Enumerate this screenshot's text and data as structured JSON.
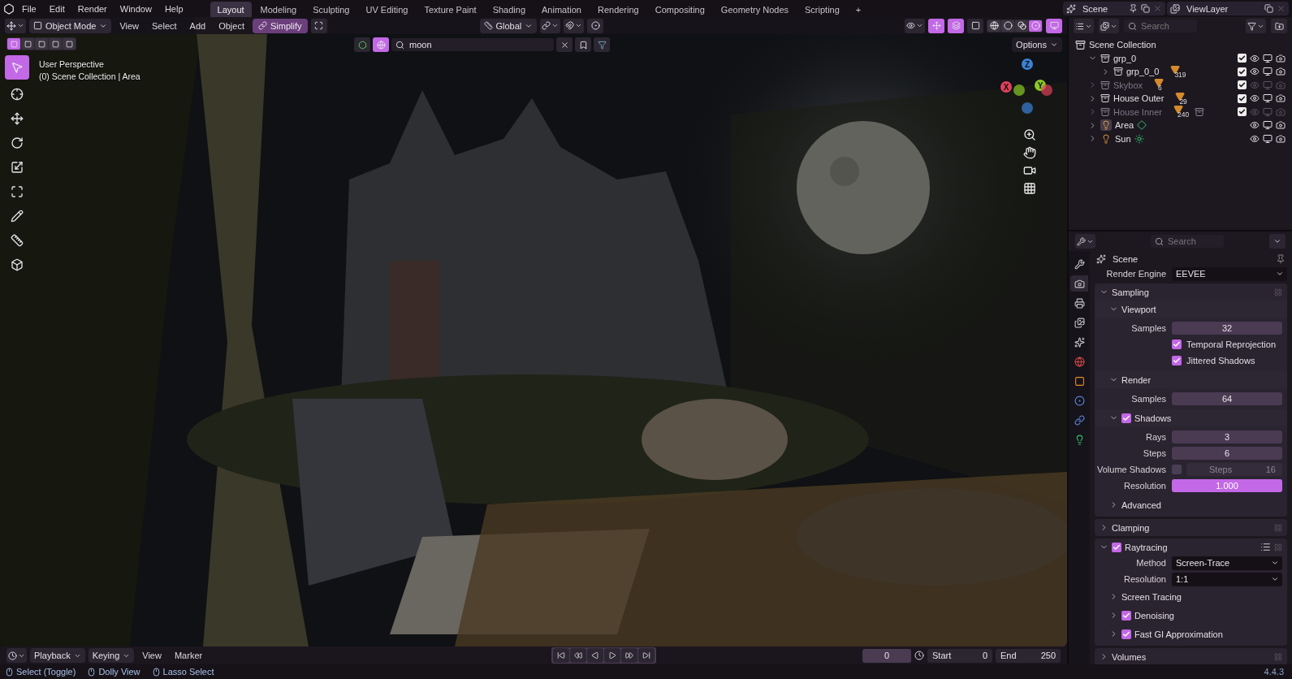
{
  "menu": [
    "File",
    "Edit",
    "Render",
    "Window",
    "Help"
  ],
  "workspaces": [
    {
      "label": "Layout",
      "selected": true
    },
    {
      "label": "Modeling",
      "selected": false
    },
    {
      "label": "Sculpting",
      "selected": false
    },
    {
      "label": "UV Editing",
      "selected": false
    },
    {
      "label": "Texture Paint",
      "selected": false
    },
    {
      "label": "Shading",
      "selected": false
    },
    {
      "label": "Animation",
      "selected": false
    },
    {
      "label": "Rendering",
      "selected": false
    },
    {
      "label": "Compositing",
      "selected": false
    },
    {
      "label": "Geometry Nodes",
      "selected": false
    },
    {
      "label": "Scripting",
      "selected": false
    }
  ],
  "add_workspace": "+",
  "scene": "Scene",
  "view_layer": "ViewLayer",
  "viewport": {
    "mode": "Object Mode",
    "menus": [
      "View",
      "Select",
      "Add",
      "Object"
    ],
    "simplify": {
      "label": "Simplify",
      "on": true
    },
    "orientation": "Global",
    "shading": [
      {
        "kind": "wireframe",
        "selected": false
      },
      {
        "kind": "solid",
        "selected": false
      },
      {
        "kind": "material",
        "selected": false
      },
      {
        "kind": "rendered",
        "selected": true
      }
    ],
    "select_modes": [
      {
        "selected": true
      },
      {
        "selected": false
      },
      {
        "selected": false
      },
      {
        "selected": false
      },
      {
        "selected": false
      }
    ],
    "filter": {
      "value": "moon"
    },
    "options": "Options",
    "info": [
      "User Perspective",
      "(0) Scene Collection | Area"
    ],
    "tools": [
      {
        "kind": "select",
        "selected": true
      },
      {
        "kind": "cursor",
        "selected": false
      },
      {
        "kind": "move",
        "selected": false
      },
      {
        "kind": "rotate",
        "selected": false
      },
      {
        "kind": "scale",
        "selected": false
      },
      {
        "kind": "transform",
        "selected": false
      },
      {
        "kind": "annotate",
        "selected": false
      },
      {
        "kind": "measure",
        "selected": false
      },
      {
        "kind": "add_cube",
        "selected": false
      }
    ],
    "axes": [
      {
        "label": "X",
        "color": "#e0405a"
      },
      {
        "label": "Y",
        "color": "#8ac926"
      },
      {
        "label": "Z",
        "color": "#3b82d6"
      }
    ]
  },
  "outliner": {
    "search": {
      "placeholder": "Search"
    },
    "root": "Scene Collection",
    "items": [
      {
        "name": "grp_0",
        "kind": "collection",
        "expanded": true,
        "visible": true,
        "checked": true,
        "children": [
          {
            "name": "grp_0_0",
            "kind": "collection",
            "expanded": false,
            "visible": true,
            "checked": true,
            "badge": "319"
          }
        ]
      },
      {
        "name": "Skybox",
        "kind": "collection",
        "expanded": false,
        "visible": false,
        "checked": true,
        "badge": "6"
      },
      {
        "name": "House Outer",
        "kind": "collection",
        "expanded": false,
        "visible": true,
        "checked": true,
        "badge": "29"
      },
      {
        "name": "House Inner",
        "kind": "collection",
        "expanded": false,
        "visible": false,
        "checked": true,
        "badge": "240",
        "extra_collection": true
      },
      {
        "name": "Area",
        "kind": "area_light",
        "expanded": false,
        "visible": true,
        "selected": true
      },
      {
        "name": "Sun",
        "kind": "sun_light",
        "expanded": false,
        "visible": true,
        "selected": false
      }
    ]
  },
  "properties": {
    "search": {
      "placeholder": "Search"
    },
    "context": "Scene",
    "tabs": [
      {
        "kind": "tool",
        "selected": false
      },
      {
        "kind": "render",
        "selected": true
      },
      {
        "kind": "output",
        "selected": false
      },
      {
        "kind": "view_layer",
        "selected": false
      },
      {
        "kind": "scene",
        "selected": false
      },
      {
        "kind": "world",
        "selected": false
      },
      {
        "kind": "object",
        "selected": false
      },
      {
        "kind": "physics",
        "selected": false
      },
      {
        "kind": "constraints",
        "selected": false
      },
      {
        "kind": "data",
        "selected": false
      }
    ],
    "render_engine": {
      "label": "Render Engine",
      "value": "EEVEE"
    },
    "sections": [
      {
        "kind": "panel",
        "title": "Sampling",
        "expanded": true,
        "children": [
          {
            "kind": "subpanel",
            "title": "Viewport",
            "expanded": true,
            "children": [
              {
                "kind": "number",
                "label": "Samples",
                "value": "32"
              },
              {
                "kind": "check",
                "label": "Temporal Reprojection",
                "checked": true
              },
              {
                "kind": "check",
                "label": "Jittered Shadows",
                "checked": true
              }
            ]
          },
          {
            "kind": "subpanel",
            "title": "Render",
            "expanded": true,
            "children": [
              {
                "kind": "number",
                "label": "Samples",
                "value": "64"
              }
            ]
          },
          {
            "kind": "subpanel",
            "title": "Shadows",
            "expanded": true,
            "checked": true,
            "children": [
              {
                "kind": "number",
                "label": "Rays",
                "value": "3"
              },
              {
                "kind": "number",
                "label": "Steps",
                "value": "6"
              },
              {
                "kind": "check_field",
                "label": "Volume Shadows",
                "checked": false,
                "disabled": true,
                "field_label": "Steps",
                "value": "16"
              },
              {
                "kind": "slider",
                "label": "Resolution",
                "value": "1.000",
                "level": 1
              }
            ]
          },
          {
            "kind": "subpanel",
            "title": "Advanced",
            "expanded": false
          }
        ]
      },
      {
        "kind": "panel",
        "title": "Clamping",
        "expanded": false
      },
      {
        "kind": "panel",
        "title": "Raytracing",
        "expanded": true,
        "checked": true,
        "presets": true,
        "children": [
          {
            "kind": "dropdown",
            "label": "Method",
            "value": "Screen-Trace"
          },
          {
            "kind": "dropdown",
            "label": "Resolution",
            "value": "1:1"
          },
          {
            "kind": "subpanel",
            "title": "Screen Tracing",
            "expanded": false
          },
          {
            "kind": "subpanel",
            "title": "Denoising",
            "expanded": false,
            "checked": true
          },
          {
            "kind": "subpanel",
            "title": "Fast GI Approximation",
            "expanded": false,
            "checked": true
          }
        ]
      },
      {
        "kind": "panel",
        "title": "Volumes",
        "expanded": false
      }
    ]
  },
  "timeline": {
    "menus": [
      "Playback",
      "Keying",
      "View",
      "Marker"
    ],
    "current_frame": "0",
    "start": {
      "label": "Start",
      "value": "0"
    },
    "end": {
      "label": "End",
      "value": "250"
    }
  },
  "status": {
    "hints": [
      "Select (Toggle)",
      "Dolly View",
      "Lasso Select"
    ],
    "version": "4.4.3"
  }
}
